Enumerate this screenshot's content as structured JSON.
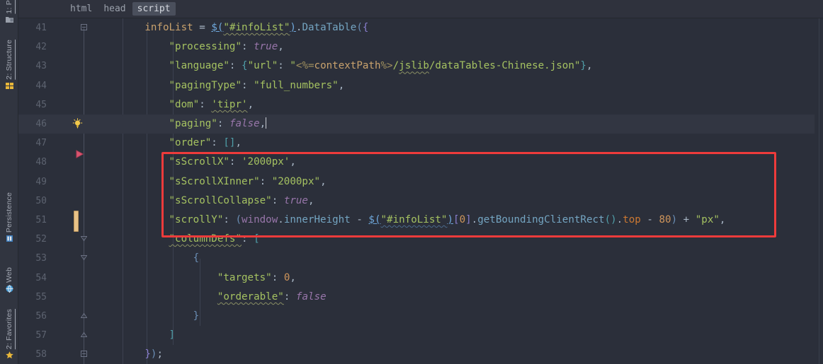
{
  "window": {
    "theme_bg": "#2b2f3a",
    "accent_red": "#ee3b3b"
  },
  "tool_sidebar": {
    "items": [
      {
        "label": "1: P",
        "icon": "project-folder-icon"
      },
      {
        "label": "2: Structure",
        "icon": "structure-icon"
      },
      {
        "label": "Persistence",
        "icon": "persistence-icon"
      },
      {
        "label": "Web",
        "icon": "web-globe-icon"
      },
      {
        "label": "2: Favorites",
        "icon": "star-icon"
      }
    ]
  },
  "breadcrumb": {
    "items": [
      {
        "label": "html",
        "selected": false
      },
      {
        "label": "head",
        "selected": false
      },
      {
        "label": "script",
        "selected": true
      }
    ]
  },
  "editor": {
    "caret_line": 46,
    "lines": [
      {
        "num": "41",
        "text": "infoList = $(\"#infoList\").DataTable({"
      },
      {
        "num": "42",
        "text": "\"processing\": true,"
      },
      {
        "num": "43",
        "text": "\"language\": {\"url\": \"<%=contextPath%>/jslib/dataTables-Chinese.json\"},"
      },
      {
        "num": "44",
        "text": "\"pagingType\": \"full_numbers\","
      },
      {
        "num": "45",
        "text": "\"dom\": 'tipr',"
      },
      {
        "num": "46",
        "text": "\"paging\": false,"
      },
      {
        "num": "47",
        "text": "\"order\": [],"
      },
      {
        "num": "48",
        "text": "\"sScrollX\": '2000px',"
      },
      {
        "num": "49",
        "text": "\"sScrollXInner\": \"2000px\","
      },
      {
        "num": "50",
        "text": "\"sScrollCollapse\": true,"
      },
      {
        "num": "51",
        "text": "\"scrollY\": (window.innerHeight - $(\"#infoList\")[0].getBoundingClientRect().top - 80) + \"px\","
      },
      {
        "num": "52",
        "text": "\"columnDefs\": ["
      },
      {
        "num": "53",
        "text": "{"
      },
      {
        "num": "54",
        "text": "\"targets\": 0,"
      },
      {
        "num": "55",
        "text": "\"orderable\": false"
      },
      {
        "num": "56",
        "text": "}"
      },
      {
        "num": "57",
        "text": "]"
      },
      {
        "num": "58",
        "text": "});"
      }
    ],
    "gutter_markers": {
      "bulb_line": "46",
      "run_marker_line": "47",
      "change_bar_line": "51"
    },
    "annotation": {
      "type": "red-rectangle",
      "covers_lines": [
        "48",
        "49",
        "50",
        "51"
      ],
      "color": "#ee3b3b"
    }
  }
}
